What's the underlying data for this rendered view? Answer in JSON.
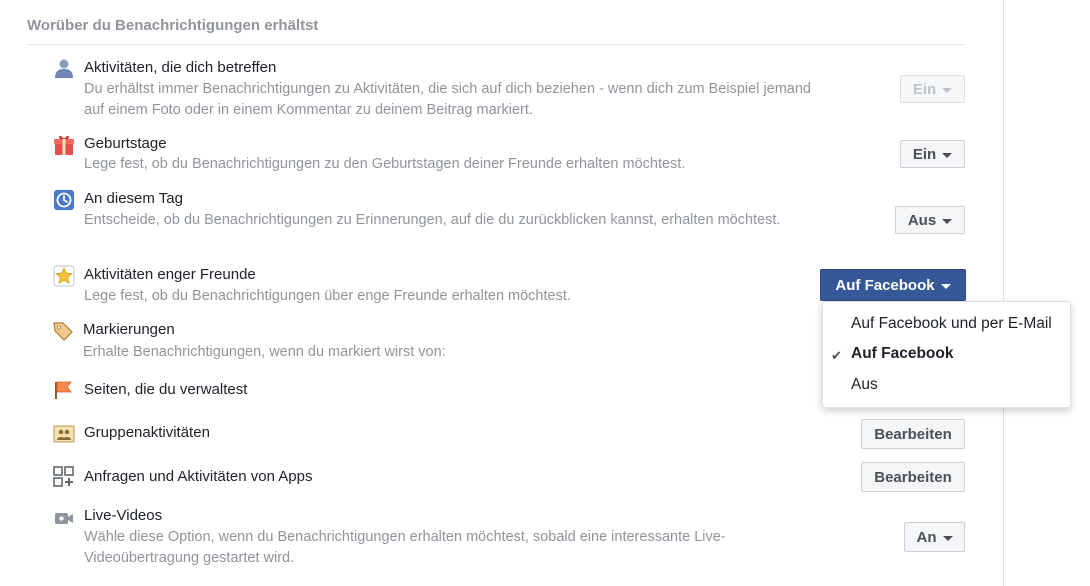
{
  "section": {
    "title": "Worüber du Benachrichtigungen erhältst"
  },
  "rows": [
    {
      "icon": "person-icon",
      "title": "Aktivitäten, die dich betreffen",
      "desc": "Du erhältst immer Benachrichtigungen zu Aktivitäten, die sich auf dich beziehen - wenn dich zum Beispiel jemand auf einem Foto oder in einem Kommentar zu deinem Beitrag markiert.",
      "button": "Ein"
    },
    {
      "icon": "gift-icon",
      "title": "Geburtstage",
      "desc": "Lege fest, ob du Benachrichtigungen zu den Geburtstagen deiner Freunde erhalten möchtest.",
      "button": "Ein"
    },
    {
      "icon": "clock-icon",
      "title": "An diesem Tag",
      "desc": "Entscheide, ob du Benachrichtigungen zu Erinnerungen, auf die du zurückblicken kannst, erhalten möchtest.",
      "button": "Aus"
    },
    {
      "icon": "star-icon",
      "title": "Aktivitäten enger Freunde",
      "desc": "Lege fest, ob du Benachrichtigungen über enge Freunde erhalten möchtest.",
      "button": "Auf Facebook"
    },
    {
      "icon": "tag-icon",
      "title": "Markierungen",
      "desc": "Erhalte Benachrichtigungen, wenn du markiert wirst von:"
    },
    {
      "icon": "flag-icon",
      "title": "Seiten, die du verwaltest"
    },
    {
      "icon": "group-icon",
      "title": "Gruppenaktivitäten",
      "button": "Bearbeiten"
    },
    {
      "icon": "apps-icon",
      "title": "Anfragen und Aktivitäten von Apps",
      "button": "Bearbeiten"
    },
    {
      "icon": "video-icon",
      "title": "Live-Videos",
      "desc": "Wähle diese Option, wenn du Benachrichtigungen erhalten möchtest, sobald eine interessante Live-Videoübertragung gestartet wird.",
      "button": "An"
    }
  ],
  "dropdown": {
    "options": [
      "Auf Facebook und per E-Mail",
      "Auf Facebook",
      "Aus"
    ],
    "selected": "Auf Facebook",
    "check_glyph": "✔"
  },
  "colors": {
    "primary": "#365899",
    "text": "#1d2129",
    "muted": "#90949c",
    "border": "#ccd0d5"
  }
}
